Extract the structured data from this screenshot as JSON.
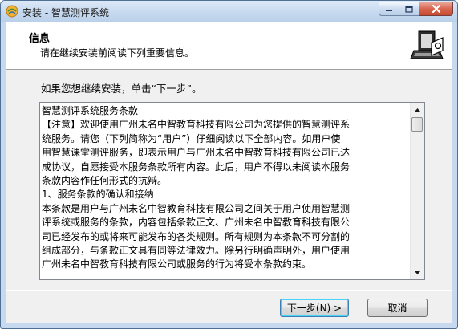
{
  "window": {
    "title": "安装 - 智慧测评系统"
  },
  "titlebar": {
    "app_icon": "installer-globe-icon",
    "minimize_icon": "minimize-icon",
    "maximize_icon": "maximize-icon",
    "close_icon": "close-icon"
  },
  "header": {
    "title": "信息",
    "subtitle": "请在继续安装前阅读下列重要信息。",
    "logo_icon": "computer-setup-icon"
  },
  "prompt": "如果您想继续安装，单击“下一步”。",
  "memo": {
    "lines": [
      "智慧测评系统服务条款",
      "【注意】欢迎使用广州未名中智教育科技有限公司为您提供的智慧测评系",
      "统服务。请您（下列简称为“用户”）仔细阅读以下全部内容。如用户使",
      "用智慧课堂测评服务，即表示用户与广州未名中智教育科技有限公司已达",
      "成协议，自愿接受本服务条款所有内容。此后，用户不得以未阅读本服务",
      "条款内容作任何形式的抗辩。",
      "1、服务条款的确认和接纳",
      "本条款是用户与广州未名中智教育科技有限公司之间关于用户使用智慧测",
      "评系统或服务的条款，内容包括条款正文、广州未名中智教育科技有限公",
      "司已经发布的或将来可能发布的各类规则。所有规则为本条款不可分割的",
      "组成部分，与条款正文具有同等法律效力。除另行明确声明外，用户使用",
      "广州未名中智教育科技有限公司或服务的行为将受本条款约束。"
    ],
    "scroll_up_icon": "scroll-up-arrow-icon",
    "scroll_down_icon": "scroll-down-arrow-icon"
  },
  "buttons": {
    "next_label": "下一步(N) >",
    "cancel_label": "取消"
  },
  "colors": {
    "title_bar": "#c6d9ef",
    "close_button": "#c44a2f",
    "default_button_border": "#3c7fb1"
  }
}
